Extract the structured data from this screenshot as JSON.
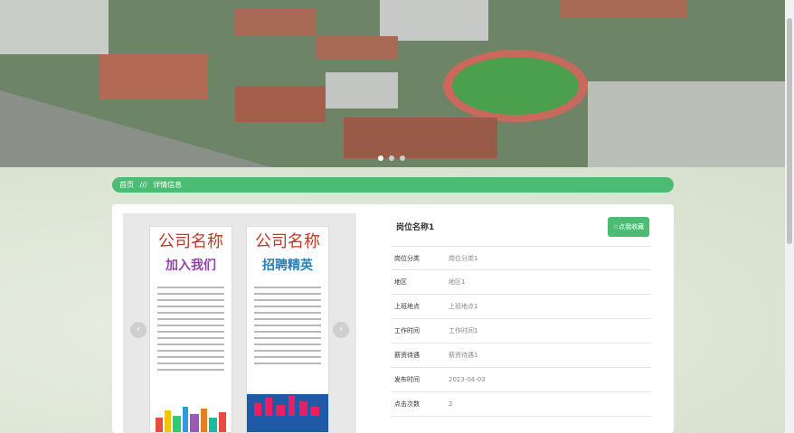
{
  "breadcrumb": {
    "home": "首页",
    "separator": "///",
    "current": "详情信息"
  },
  "job": {
    "title": "岗位名称1",
    "favorite_label": "☆点我收藏",
    "fields": [
      {
        "key": "岗位分类",
        "value": "岗位分类1"
      },
      {
        "key": "地区",
        "value": "地区1"
      },
      {
        "key": "上班地点",
        "value": "上班地点1"
      },
      {
        "key": "工作时间",
        "value": "工作时间1"
      },
      {
        "key": "薪资待遇",
        "value": "薪资待遇1"
      },
      {
        "key": "发布时间",
        "value": "2023-04-03"
      },
      {
        "key": "点击次数",
        "value": "2"
      }
    ]
  },
  "gallery": {
    "posters": [
      {
        "title": "公司名称",
        "subtitle": "加入我们"
      },
      {
        "title": "公司名称",
        "subtitle": "招聘精英"
      }
    ],
    "prev_icon": "chevron-left-icon",
    "next_icon": "chevron-right-icon"
  },
  "colors": {
    "accent": "#4cbc74",
    "card": "#ffffff",
    "background": "#dfe6d8"
  }
}
